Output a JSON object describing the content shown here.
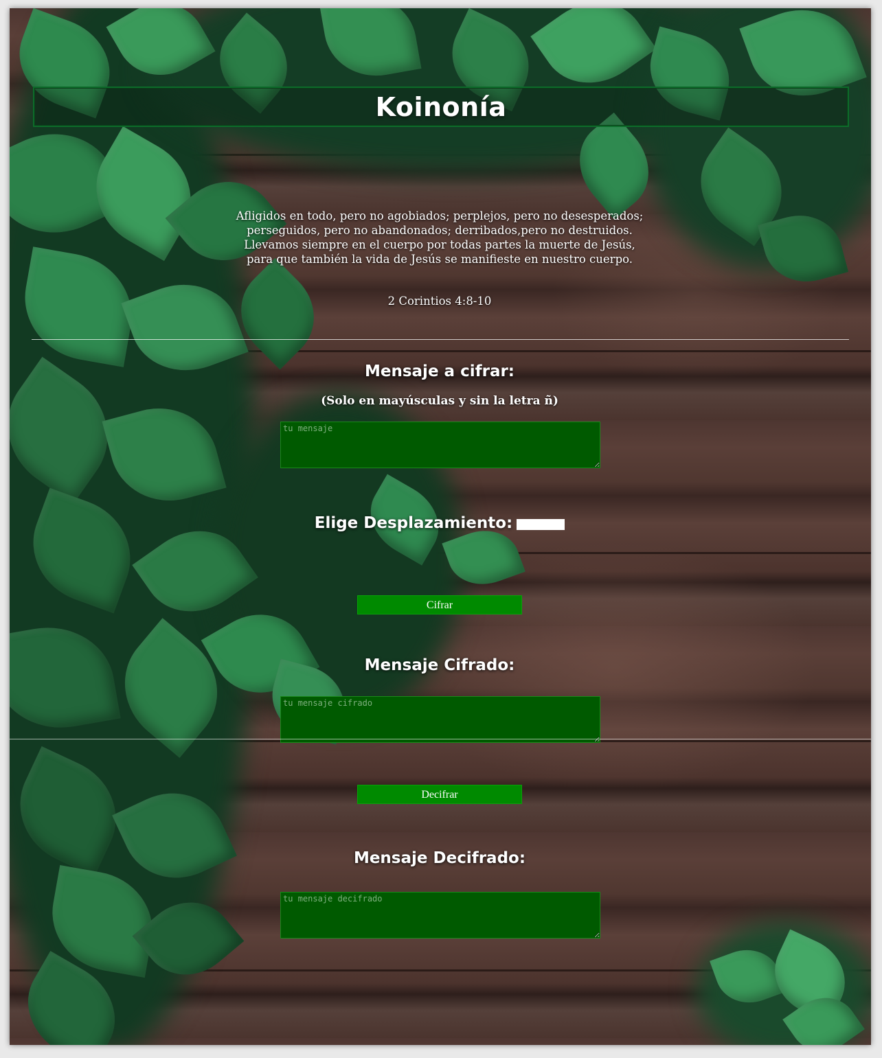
{
  "header": {
    "title": "Koinonía"
  },
  "verse": {
    "lines": [
      "Afligidos en todo, pero no agobiados; perplejos, pero no desesperados;",
      "perseguidos, pero no abandonados; derribados,pero no destruidos.",
      "Llevamos siempre en el cuerpo por todas partes la muerte de Jesús,",
      "para que también la vida de Jesús se manifieste en nuestro cuerpo."
    ],
    "reference": "2 Corintios 4:8-10"
  },
  "cipher": {
    "input_heading": "Mensaje a cifrar:",
    "input_note": "(Solo en mayúsculas y sin la letra ñ)",
    "input_placeholder": "tu mensaje",
    "input_value": "",
    "shift_label": "Elige Desplazamiento:",
    "shift_value": "",
    "cipher_button": "Cifrar",
    "output_heading": "Mensaje Cifrado:",
    "output_placeholder": "tu mensaje cifrado",
    "decipher_button": "Decifrar",
    "decoded_heading": "Mensaje Decifrado:",
    "decoded_placeholder": "tu mensaje decifrado"
  },
  "colors": {
    "button_bg": "#008a00",
    "textarea_bg": "#005a00",
    "title_border": "#0d6b2a",
    "wood": "#4e3631",
    "ivy": "#1f6b3a"
  }
}
